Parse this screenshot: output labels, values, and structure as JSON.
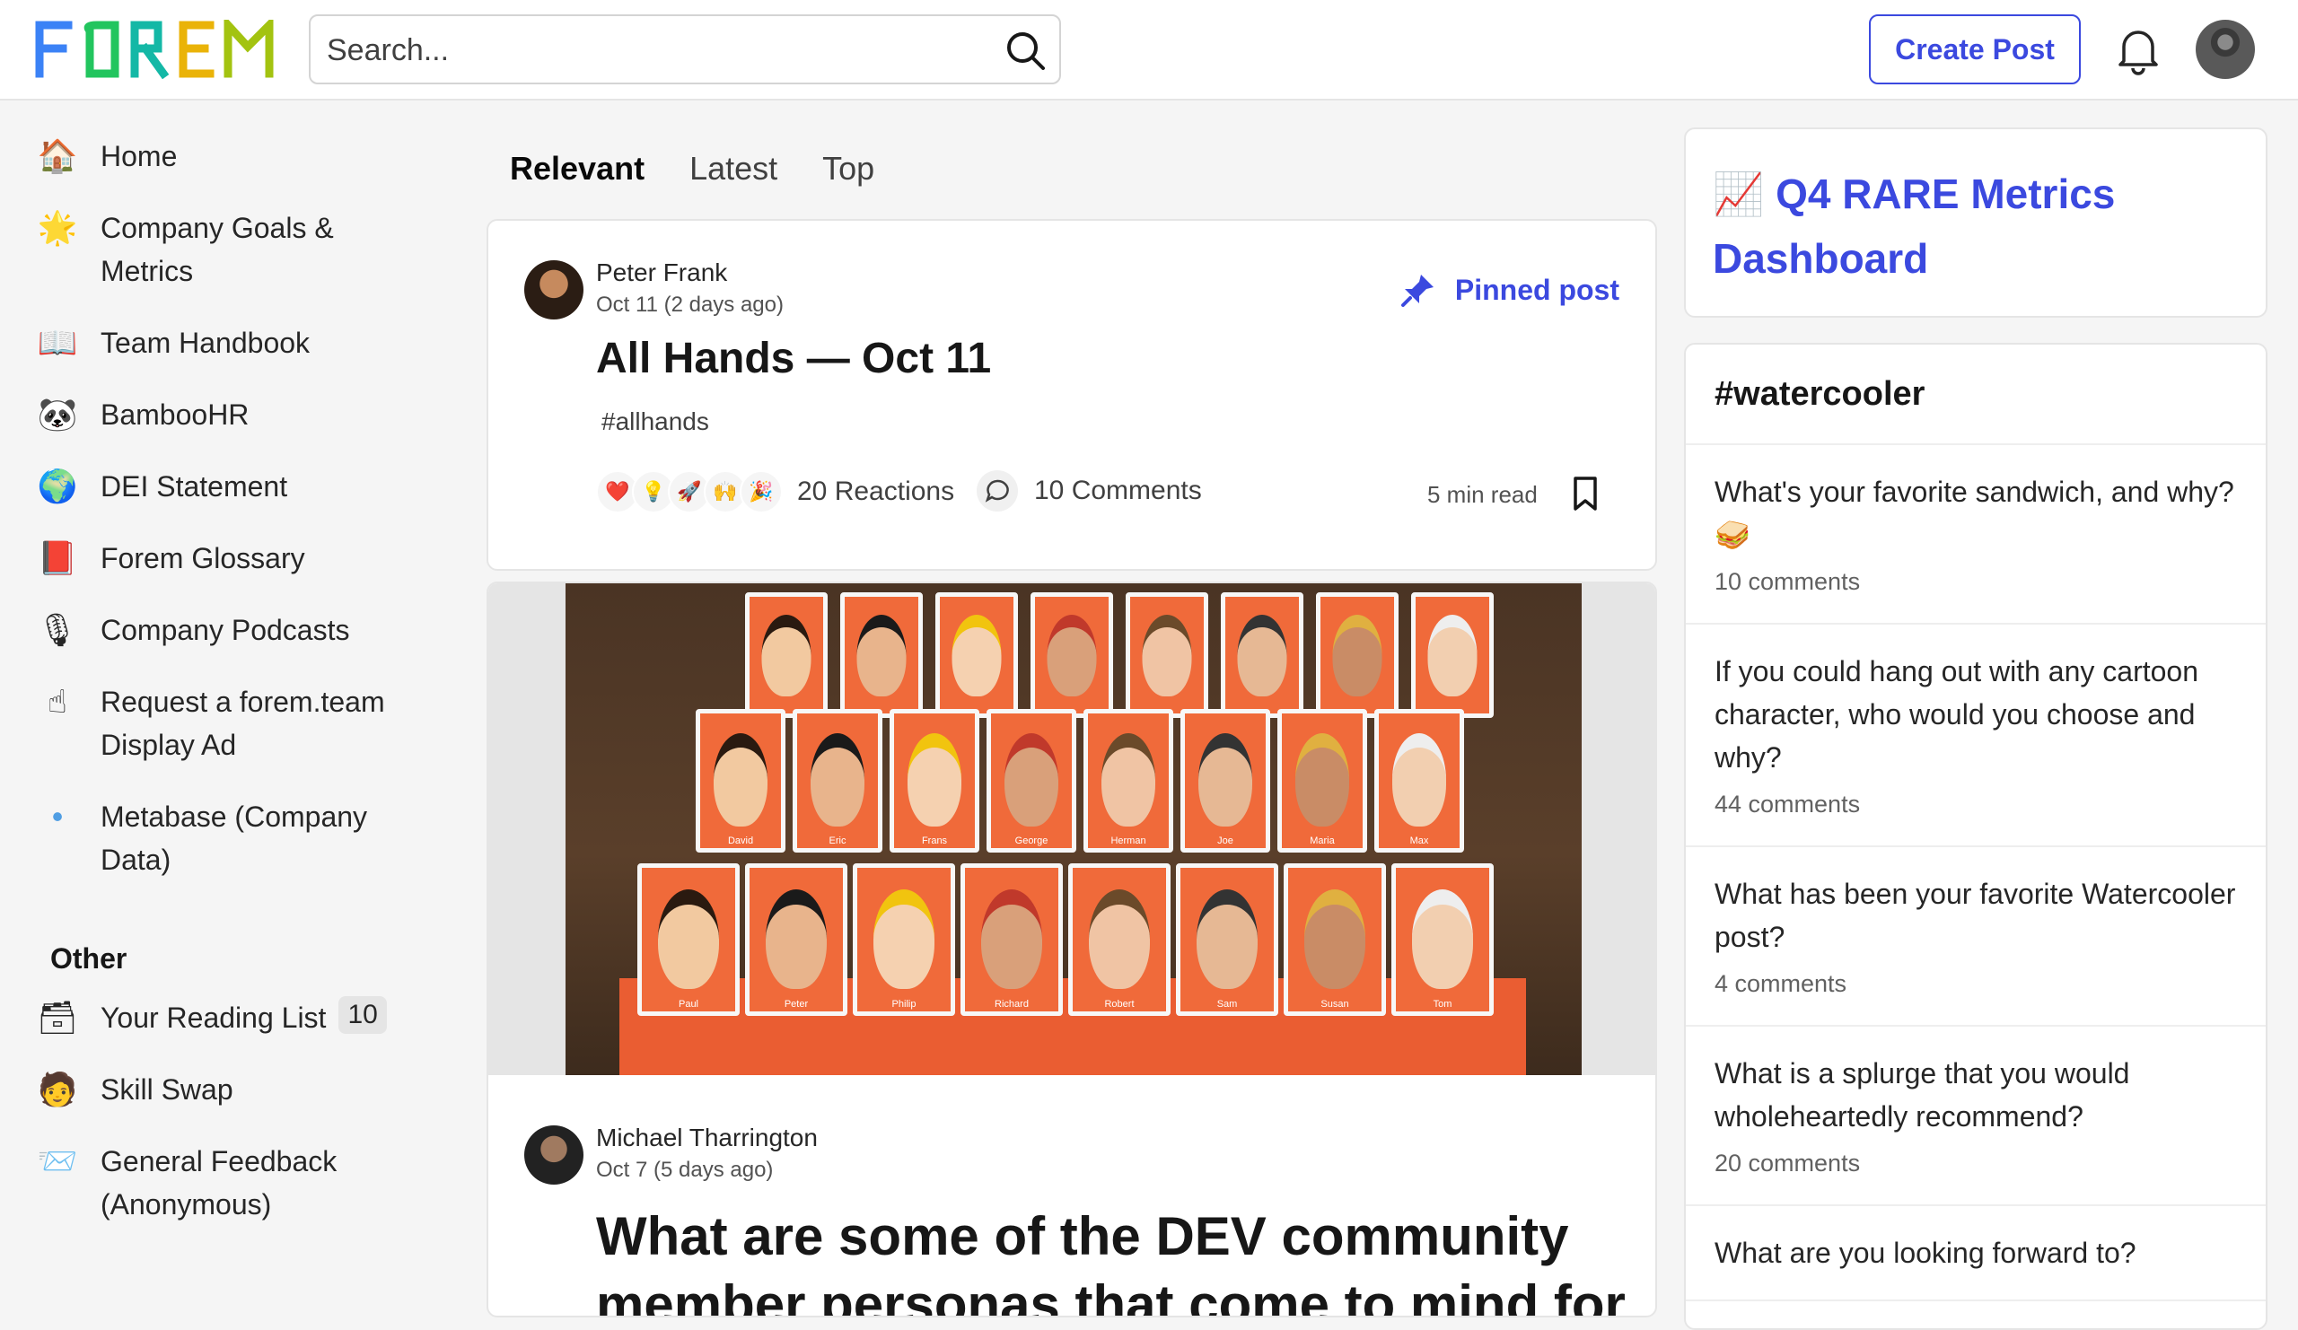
{
  "header": {
    "logo_text": "FOREM",
    "search_placeholder": "Search...",
    "create_post": "Create Post"
  },
  "sidebar": {
    "items": [
      {
        "icon": "house-icon",
        "emoji": "🏠",
        "label": "Home"
      },
      {
        "icon": "star-icon",
        "emoji": "🌟",
        "label": "Company Goals & Metrics"
      },
      {
        "icon": "book-icon",
        "emoji": "📖",
        "label": "Team Handbook"
      },
      {
        "icon": "panda-icon",
        "emoji": "🐼",
        "label": "BambooHR"
      },
      {
        "icon": "globe-icon",
        "emoji": "🌍",
        "label": "DEI Statement"
      },
      {
        "icon": "red-book-icon",
        "emoji": "📕",
        "label": "Forem Glossary"
      },
      {
        "icon": "microphone-icon",
        "emoji": "🎙",
        "label": "Company Podcasts"
      },
      {
        "icon": "pointing-up-icon",
        "emoji": "☝",
        "label": "Request a forem.team Display Ad"
      },
      {
        "icon": "metabase-icon",
        "emoji": "•",
        "label": "Metabase (Company Data)"
      }
    ],
    "other_title": "Other",
    "other_items": [
      {
        "icon": "reading-list-icon",
        "emoji": "🗃",
        "label": "Your Reading List",
        "badge": "10"
      },
      {
        "icon": "skill-swap-icon",
        "emoji": "🧑",
        "label": "Skill Swap"
      },
      {
        "icon": "feedback-icon",
        "emoji": "📨",
        "label": "General Feedback (Anonymous)"
      }
    ]
  },
  "feed": {
    "tabs": [
      "Relevant",
      "Latest",
      "Top"
    ],
    "active_tab": "Relevant",
    "posts": [
      {
        "author": "Peter Frank",
        "date": "Oct 11 (2 days ago)",
        "pinned_label": "Pinned post",
        "title": "All Hands — Oct 11",
        "tag": "#allhands",
        "reaction_emojis": [
          "❤️",
          "💡",
          "🚀",
          "🙌",
          "🎉"
        ],
        "reactions": "20 Reactions",
        "comments": "10 Comments",
        "read_time": "5 min read"
      },
      {
        "author": "Michael Tharrington",
        "date": "Oct 7 (5 days ago)",
        "title": "What are some of the DEV community member personas that come to mind for",
        "cover_names_row1": [
          "David",
          "Eric",
          "Frans",
          "George",
          "Herman",
          "Joe",
          "Maria",
          "Max"
        ],
        "cover_names_row2": [
          "Paul",
          "Peter",
          "Philip",
          "Richard",
          "Robert",
          "Sam",
          "Susan",
          "Tom"
        ]
      }
    ]
  },
  "right": {
    "metrics_emoji": "📈",
    "metrics_title": "Q4 RARE Metrics Dashboard",
    "watercooler_title": "#watercooler",
    "threads": [
      {
        "q": "What's your favorite sandwich, and why? 🥪",
        "c": "10 comments"
      },
      {
        "q": "If you could hang out with any cartoon character, who would you choose and why?",
        "c": "44 comments"
      },
      {
        "q": "What has been your favorite Watercooler post?",
        "c": "4 comments"
      },
      {
        "q": "What is a splurge that you would wholeheartedly recommend?",
        "c": "20 comments"
      },
      {
        "q": "What are you looking forward to?",
        "c": ""
      }
    ]
  },
  "colors": {
    "accent": "#3b49df",
    "board": "#ea5d32"
  }
}
